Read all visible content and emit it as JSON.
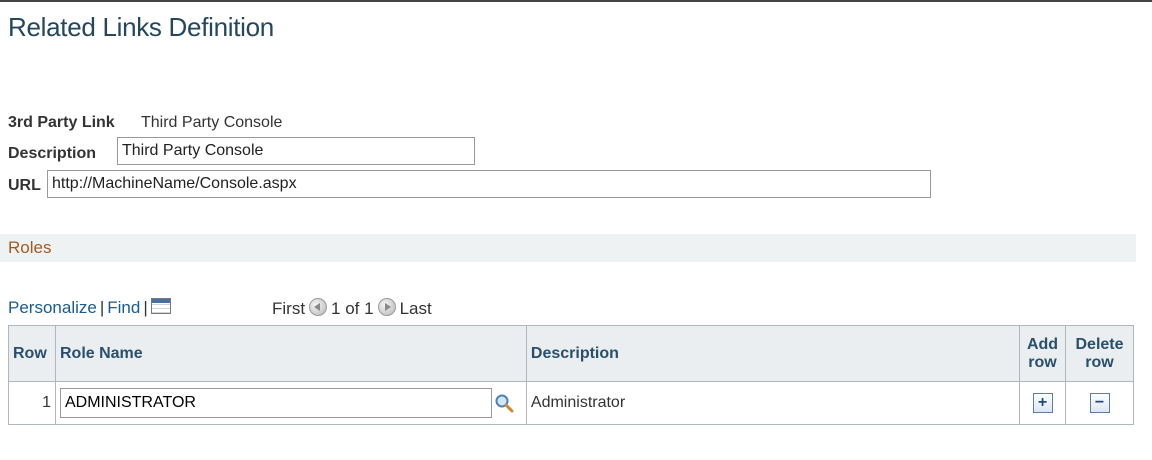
{
  "page": {
    "title": "Related Links Definition"
  },
  "form": {
    "third_party_link_label": "3rd Party Link",
    "third_party_link_value": "Third Party Console",
    "description_label": "Description",
    "description_value": "Third Party Console",
    "url_label": "URL",
    "url_value": "http://MachineName/Console.aspx"
  },
  "roles_section": {
    "title": "Roles"
  },
  "grid_nav": {
    "personalize": "Personalize",
    "separator": "|",
    "find": "Find",
    "view_all_icon": "grid-icon",
    "first": "First",
    "range": "1 of 1",
    "last": "Last"
  },
  "table": {
    "headers": {
      "row": "Row",
      "role_name": "Role Name",
      "description": "Description",
      "add_row_1": "Add",
      "add_row_2": "row",
      "delete_row_1": "Delete",
      "delete_row_2": "row"
    },
    "rows": [
      {
        "num": "1",
        "role_name": "ADMINISTRATOR",
        "description": "Administrator"
      }
    ],
    "add_symbol": "+",
    "delete_symbol": "−"
  },
  "icons": {
    "lookup": "magnifier-icon",
    "prev": "left-arrow-icon",
    "next": "right-arrow-icon"
  },
  "colors": {
    "title": "#24475e",
    "section_title": "#a25a22",
    "link": "#1a5b92",
    "header_bg": "#eaeef1"
  }
}
